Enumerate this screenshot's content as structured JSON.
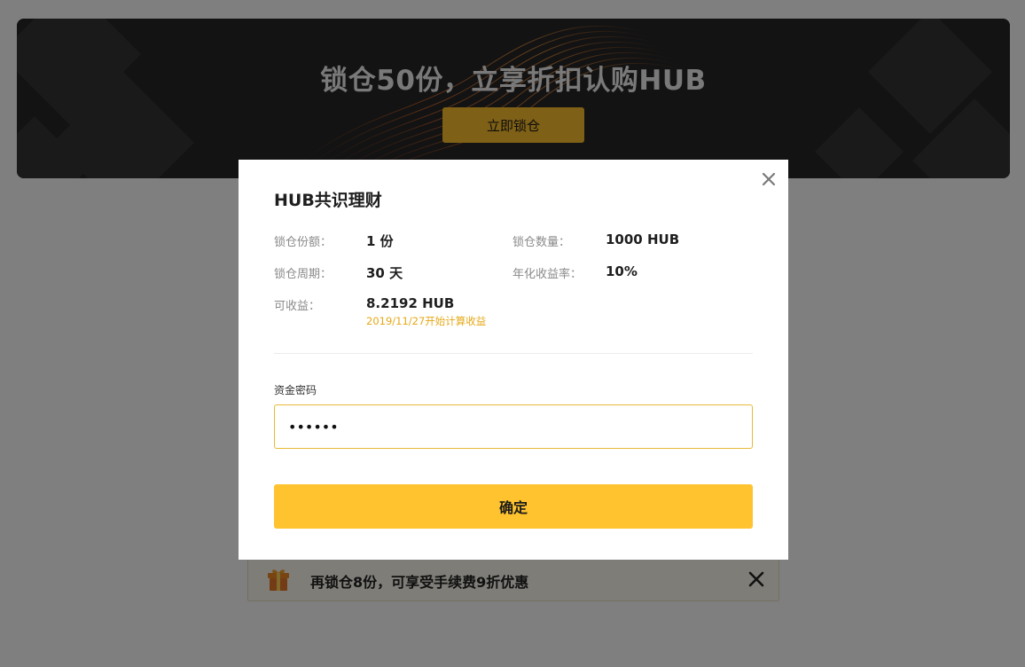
{
  "banner": {
    "title": "锁仓50份，立享折扣认购HUB",
    "button_label": "立即锁仓"
  },
  "promo": {
    "icon": "gift-icon",
    "text": "再锁仓8份，可享受手续费9折优惠",
    "close_icon": "close-icon"
  },
  "modal": {
    "title": "HUB共识理财",
    "close_icon": "close-icon",
    "details": {
      "shares_label": "锁仓份额：",
      "shares_value": "1 份",
      "amount_label": "锁仓数量：",
      "amount_value": "1000 HUB",
      "period_label": "锁仓周期：",
      "period_value": "30 天",
      "rate_label": "年化收益率：",
      "rate_value": "10%",
      "earnings_label": "可收益：",
      "earnings_value": "8.2192 HUB",
      "earnings_note": "2019/11/27开始计算收益"
    },
    "password": {
      "label": "资金密码",
      "value": "••••••"
    },
    "confirm_label": "确定"
  },
  "colors": {
    "accent": "#fec32e",
    "note": "#e6a817",
    "overlay": "rgba(0,0,0,0.5)"
  }
}
